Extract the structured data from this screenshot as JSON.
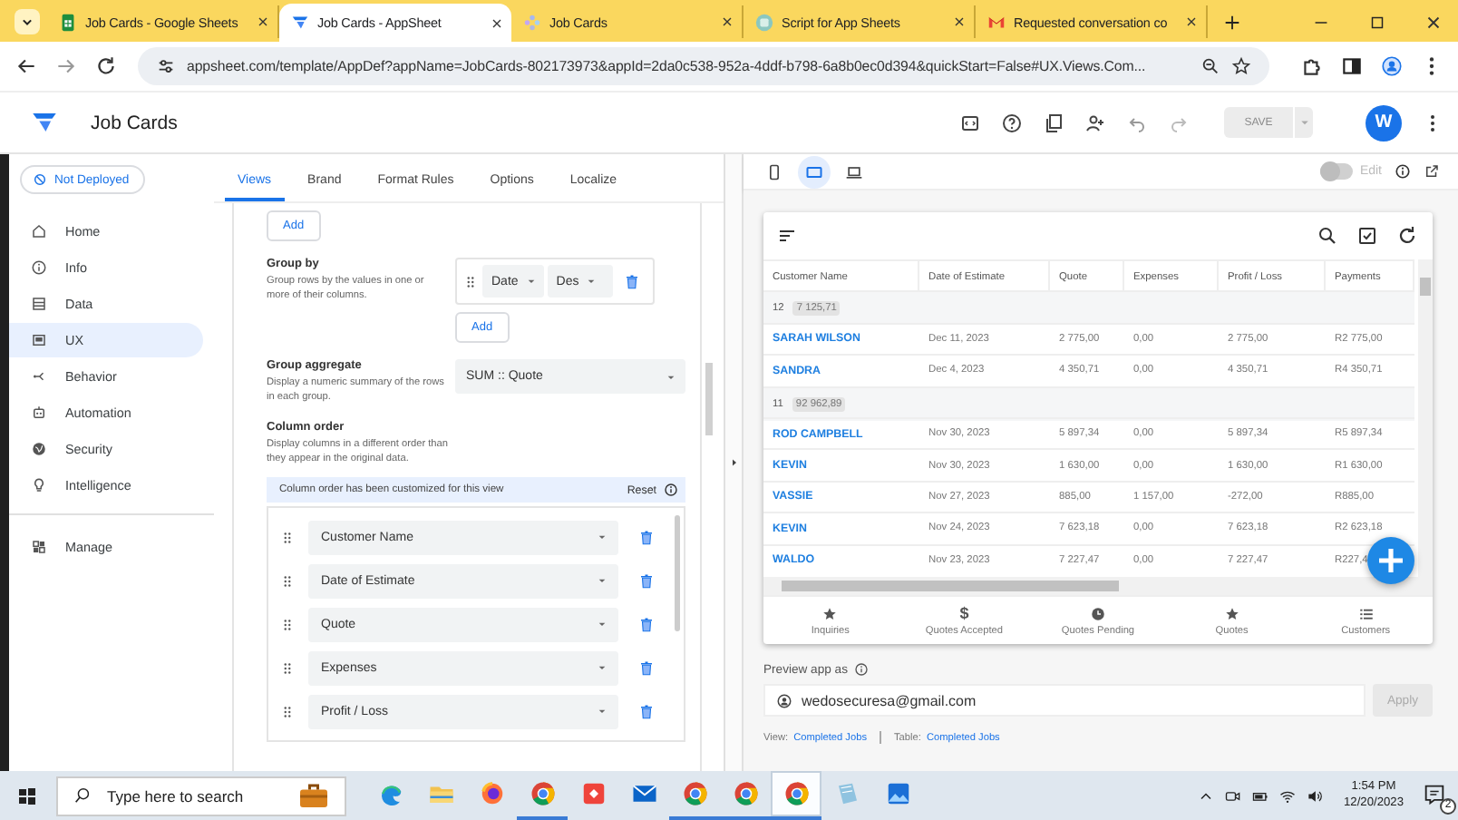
{
  "browser": {
    "tabs": [
      {
        "title": "Job Cards - Google Sheets",
        "selected": false
      },
      {
        "title": "Job Cards - AppSheet",
        "selected": true
      },
      {
        "title": "Job Cards",
        "selected": false
      },
      {
        "title": "Script for App Sheets",
        "selected": false
      },
      {
        "title": "Requested conversation co",
        "selected": false
      }
    ],
    "url": "appsheet.com/template/AppDef?appName=JobCards-802173973&appId=2da0c538-952a-4ddf-b798-6a8b0ec0d394&quickStart=False#UX.Views.Com..."
  },
  "app": {
    "title": "Job Cards",
    "save": {
      "label": "SAVE",
      "disabled": true
    },
    "avatar": "W"
  },
  "sidebar": {
    "status": "Not Deployed",
    "groups": [
      [
        {
          "label": "Home",
          "selected": false
        },
        {
          "label": "Info",
          "selected": false
        },
        {
          "label": "Data",
          "selected": false
        },
        {
          "label": "UX",
          "selected": true
        },
        {
          "label": "Behavior",
          "selected": false
        },
        {
          "label": "Automation",
          "selected": false
        },
        {
          "label": "Security",
          "selected": false
        },
        {
          "label": "Intelligence",
          "selected": false
        }
      ],
      [
        {
          "label": "Manage",
          "selected": false
        }
      ]
    ]
  },
  "editor": {
    "tabs": [
      {
        "label": "Views",
        "selected": true
      },
      {
        "label": "Brand",
        "selected": false
      },
      {
        "label": "Format Rules",
        "selected": false
      },
      {
        "label": "Options",
        "selected": false
      },
      {
        "label": "Localize",
        "selected": false
      }
    ],
    "add_button": "Add",
    "group_by": {
      "title": "Group by",
      "description": "Group rows by the values in one or more of their columns.",
      "fields": [
        "Date",
        "Des"
      ],
      "add_button": "Add"
    },
    "group_aggregate": {
      "title": "Group aggregate",
      "description": "Display a numeric summary of the rows in each group.",
      "value": "SUM :: Quote"
    },
    "column_order": {
      "title": "Column order",
      "description": "Display columns in a different order than they appear in the original data.",
      "notice": "Column order has been customized for this view",
      "reset": "Reset",
      "columns": [
        "Customer Name",
        "Date of Estimate",
        "Quote",
        "Expenses",
        "Profit / Loss"
      ]
    }
  },
  "preview": {
    "devices": [
      {
        "selected": false
      },
      {
        "selected": true
      },
      {
        "selected": false
      }
    ],
    "edit_toggle": {
      "label": "Edit",
      "on": false
    },
    "table": {
      "columns": [
        "Customer Name",
        "Date of Estimate",
        "Quote",
        "Expenses",
        "Profit / Loss",
        "Payments"
      ],
      "rows": [
        {
          "kind": "group",
          "count": "12",
          "total": "7 125,71"
        },
        {
          "kind": "record",
          "cells": [
            "SARAH WILSON",
            "Dec 11, 2023",
            "2 775,00",
            "0,00",
            "2 775,00",
            "R2 775,00"
          ]
        },
        {
          "kind": "record",
          "cells": [
            "SANDRA",
            "Dec 4, 2023",
            "4 350,71",
            "0,00",
            "4 350,71",
            "R4 350,71"
          ]
        },
        {
          "kind": "group",
          "count": "11",
          "total": "92 962,89"
        },
        {
          "kind": "record",
          "cells": [
            "ROD CAMPBELL",
            "Nov 30, 2023",
            "5 897,34",
            "0,00",
            "5 897,34",
            "R5 897,34"
          ]
        },
        {
          "kind": "record",
          "cells": [
            "KEVIN",
            "Nov 30, 2023",
            "1 630,00",
            "0,00",
            "1 630,00",
            "R1 630,00"
          ]
        },
        {
          "kind": "record",
          "cells": [
            "VASSIE",
            "Nov 27, 2023",
            "885,00",
            "1 157,00",
            "-272,00",
            "R885,00"
          ]
        },
        {
          "kind": "record",
          "cells": [
            "KEVIN",
            "Nov 24, 2023",
            "7 623,18",
            "0,00",
            "7 623,18",
            "R2 623,18"
          ]
        },
        {
          "kind": "record",
          "cells": [
            "WALDO",
            "Nov 23, 2023",
            "7 227,47",
            "0,00",
            "7 227,47",
            "R227,4"
          ]
        }
      ]
    },
    "nav": [
      {
        "label": "Inquiries",
        "kind": "star"
      },
      {
        "label": "Quotes Accepted",
        "kind": "symbol",
        "symbol": "$"
      },
      {
        "label": "Quotes Pending",
        "kind": "clock"
      },
      {
        "label": "Quotes",
        "kind": "star"
      },
      {
        "label": "Customers",
        "kind": "list"
      }
    ],
    "preview_as": {
      "label": "Preview app as",
      "value": "wedosecuresa@gmail.com",
      "button": "Apply"
    },
    "footer": {
      "view_label": "View:",
      "view": "Completed Jobs",
      "table_label": "Table:",
      "table": "Completed Jobs"
    }
  },
  "taskbar": {
    "search_placeholder": "Type here to search",
    "apps": [
      {
        "running": false,
        "selected": false
      },
      {
        "running": false,
        "selected": false
      },
      {
        "running": false,
        "selected": false
      },
      {
        "running": true,
        "selected": false
      },
      {
        "running": false,
        "selected": false
      },
      {
        "running": false,
        "selected": false
      },
      {
        "running": true,
        "selected": false
      },
      {
        "running": true,
        "selected": false
      },
      {
        "running": true,
        "selected": true
      },
      {
        "running": false,
        "selected": false
      },
      {
        "running": false,
        "selected": false
      }
    ],
    "time": "1:54 PM",
    "date": "12/20/2023",
    "notifications": "2"
  }
}
